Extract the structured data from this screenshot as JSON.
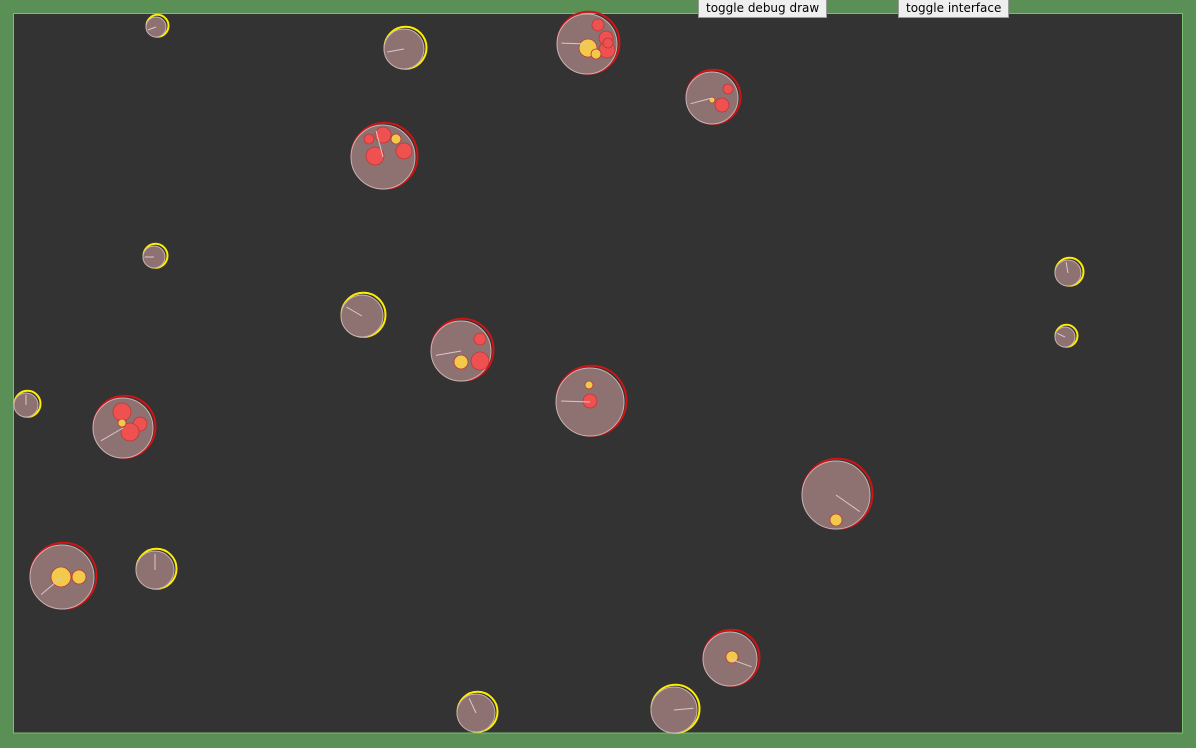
{
  "buttons": {
    "debug_label": "toggle debug draw",
    "interface_label": "toggle interface"
  },
  "colors": {
    "background": "#333333",
    "wall": "#5a8f55",
    "wall_edge": "#7bbf72",
    "cell_body": "#8e7272",
    "cell_body_edge": "#c8b3b3",
    "red_cell_outline": "#cc1515",
    "yellow_cell_outline": "#ffee00",
    "food_red": "#ef5050",
    "food_yellow": "#f3c94c",
    "heading_line": "#d8c8c8"
  },
  "cells": [
    {
      "type": "yellow",
      "size": "small"
    },
    {
      "type": "yellow",
      "size": "medium"
    },
    {
      "type": "red",
      "size": "large",
      "food": [
        "red",
        "red",
        "yellow",
        "red",
        "red",
        "yellow"
      ]
    },
    {
      "type": "red",
      "size": "medium",
      "food": [
        "red",
        "red",
        "yellow"
      ]
    },
    {
      "type": "red",
      "size": "large",
      "food": [
        "red",
        "red",
        "yellow",
        "red",
        "red"
      ]
    },
    {
      "type": "yellow",
      "size": "small"
    },
    {
      "type": "yellow",
      "size": "medium"
    },
    {
      "type": "red",
      "size": "large",
      "food": [
        "red",
        "red",
        "yellow"
      ]
    },
    {
      "type": "red",
      "size": "large",
      "food": [
        "yellow",
        "red"
      ]
    },
    {
      "type": "yellow",
      "size": "small"
    },
    {
      "type": "yellow",
      "size": "small"
    },
    {
      "type": "yellow",
      "size": "small"
    },
    {
      "type": "red",
      "size": "large",
      "food": [
        "red",
        "red",
        "red",
        "yellow"
      ]
    },
    {
      "type": "red",
      "size": "large",
      "food": [
        "yellow"
      ]
    },
    {
      "type": "red",
      "size": "large",
      "food": [
        "yellow",
        "yellow"
      ]
    },
    {
      "type": "yellow",
      "size": "medium"
    },
    {
      "type": "red",
      "size": "medium",
      "food": [
        "yellow"
      ]
    },
    {
      "type": "yellow",
      "size": "medium"
    },
    {
      "type": "yellow",
      "size": "medium"
    }
  ]
}
